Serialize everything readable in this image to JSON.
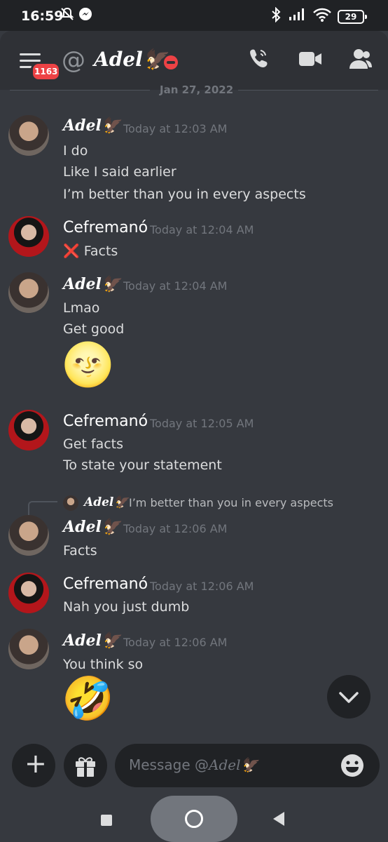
{
  "status_bar": {
    "time": "16:59",
    "battery": "29"
  },
  "header": {
    "badge_count": "1163",
    "at_symbol": "@",
    "channel_name": "Adel🦅"
  },
  "date_divider": "Jan 27, 2022",
  "messages": [
    {
      "author": "Adel🦅",
      "timestamp": "Today at 12:03 AM",
      "lines": [
        "I do",
        "Like I said earlier",
        "I’m better than you in every aspects"
      ]
    },
    {
      "author": "Cefremanó",
      "timestamp": "Today at 12:04 AM",
      "lines": [
        "❌ Facts"
      ]
    },
    {
      "author": "Adel🦅",
      "timestamp": "Today at 12:04 AM",
      "lines": [
        "Lmao",
        "Get good"
      ],
      "emoji": "🌝"
    },
    {
      "author": "Cefremanó",
      "timestamp": "Today at 12:05 AM",
      "lines": [
        "Get facts",
        "To state your statement"
      ]
    },
    {
      "reply_to": {
        "author": "Adel🦅",
        "text": "I’m better than you in every aspects"
      },
      "author": "Adel🦅",
      "timestamp": "Today at 12:06 AM",
      "lines": [
        "Facts"
      ]
    },
    {
      "author": "Cefremanó",
      "timestamp": "Today at 12:06 AM",
      "lines": [
        "Nah you just dumb"
      ]
    },
    {
      "author": "Adel🦅",
      "timestamp": "Today at 12:06 AM",
      "lines": [
        "You think so"
      ],
      "emoji": "🤣"
    }
  ],
  "composer": {
    "placeholder_prefix": "Message @",
    "placeholder_name": "Adel🦅",
    "add_symbol": "+"
  },
  "colors": {
    "background": "#36393f",
    "header": "#2f3136",
    "input": "#202225",
    "badge": "#ed4245",
    "muted_text": "#72767d"
  }
}
